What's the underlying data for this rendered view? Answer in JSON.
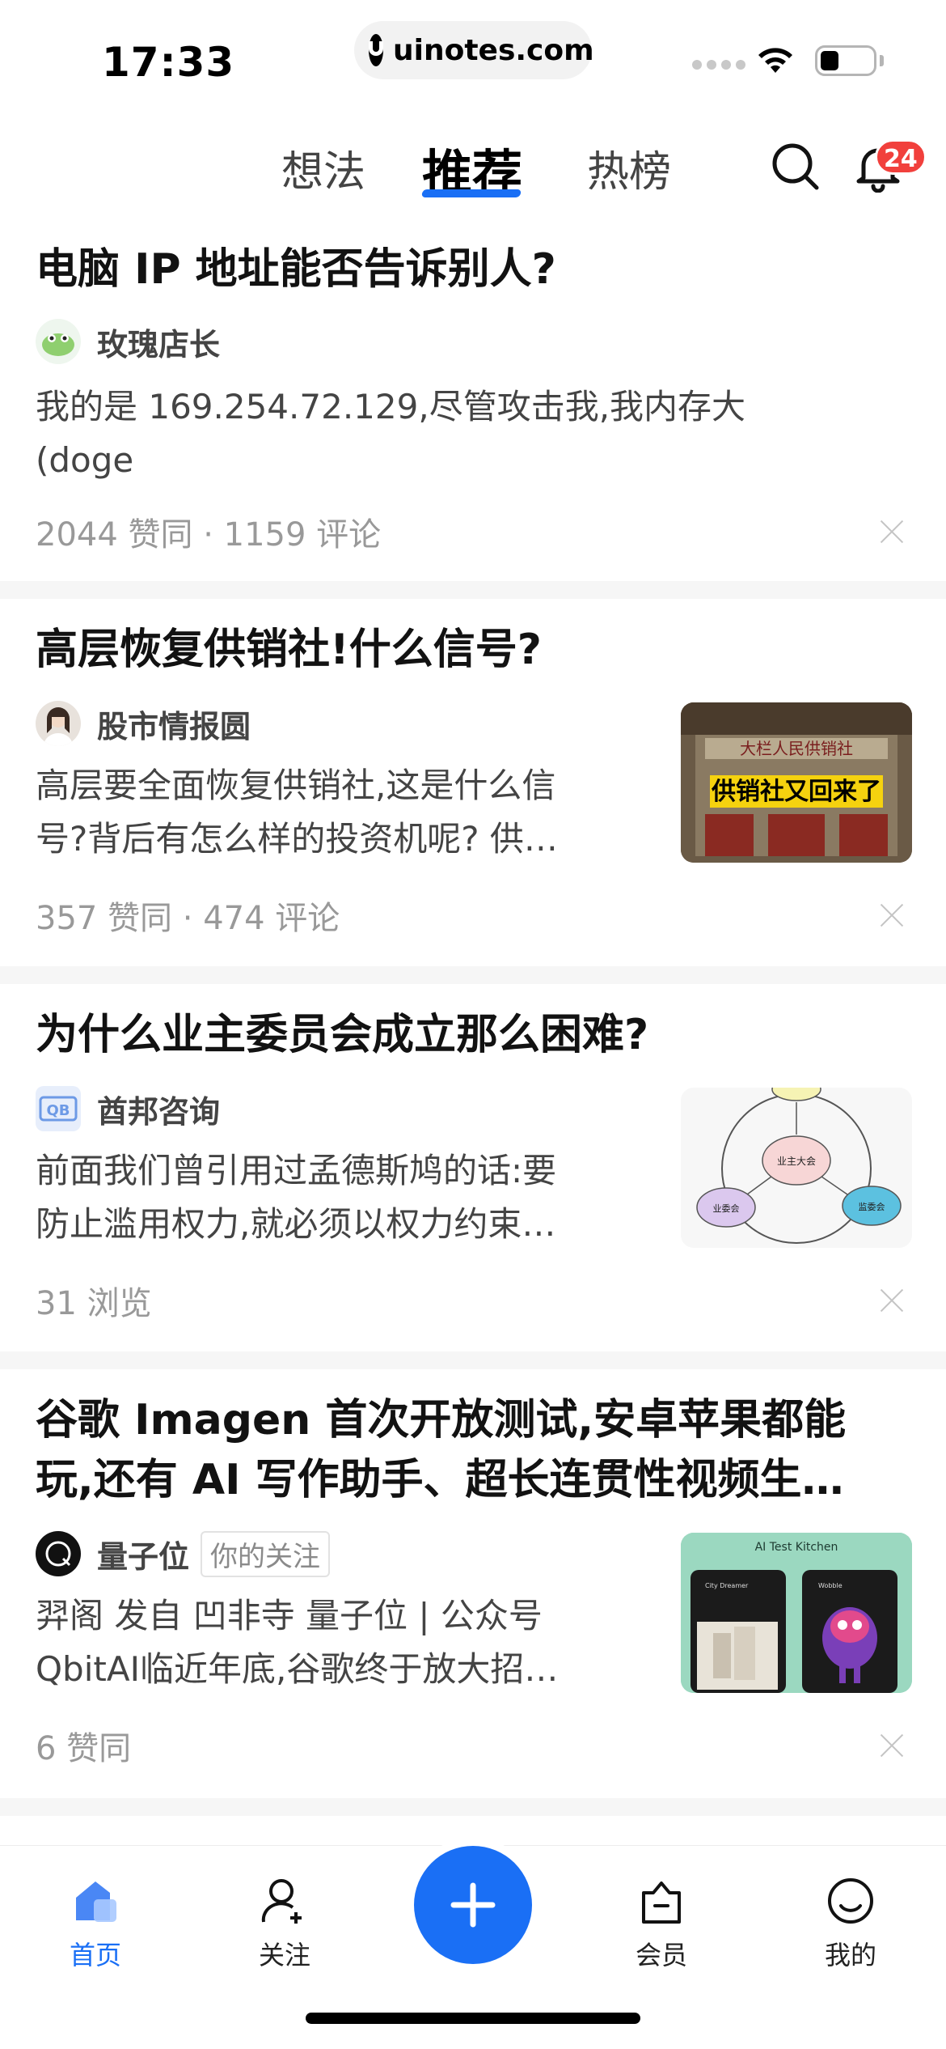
{
  "status_bar": {
    "time": "17:33",
    "url": "uinotes.com"
  },
  "top_nav": {
    "tabs": [
      {
        "label": "想法"
      },
      {
        "label": "推荐"
      },
      {
        "label": "热榜"
      }
    ],
    "active_tab": "推荐",
    "notification_count": "24"
  },
  "feed": [
    {
      "title": "电脑 IP 地址能否告诉别人?",
      "author": "玫瑰店长",
      "excerpt_line1": "我的是 169.254.72.129,尽管攻击我,我内存大",
      "excerpt_line2": "(doge",
      "meta": "2044 赞同 · 1159 评论"
    },
    {
      "title": "高层恢复供销社!什么信号?",
      "author": "股市情报圆",
      "excerpt_line1": "高层要全面恢复供销社,这是什么信",
      "excerpt_line2": "号?背后有怎么样的投资机呢? 供…",
      "meta": "357 赞同 · 474 评论",
      "thumb_sign": "大栏人民供销社",
      "thumb_banner": "供销社又回来了"
    },
    {
      "title": "为什么业主委员会成立那么困难?",
      "author": "酋邦咨询",
      "excerpt_line1": "前面我们曾引用过孟德斯鸠的话:要",
      "excerpt_line2": "防止滥用权力,就必须以权力约束…",
      "meta": "31 浏览",
      "thumb_nodes": [
        "业主大会",
        "业委会",
        "监委会"
      ]
    },
    {
      "title_line1": "谷歌 Imagen 首次开放测试,安卓苹果都能",
      "title_line2": "玩,还有 AI 写作助手、超长连贯性视频生…",
      "author": "量子位",
      "follow_tag": "你的关注",
      "excerpt_line1": "羿阁 发自 凹非寺 量子位 | 公众号",
      "excerpt_line2": "QbitAI临近年底,谷歌终于放大招…",
      "meta": "6 赞同",
      "thumb_caption": "AI Test Kitchen",
      "thumb_left_label": "City Dreamer",
      "thumb_right_label": "Wobble"
    }
  ],
  "bottom_nav": [
    {
      "label": "首页",
      "icon": "home-icon"
    },
    {
      "label": "关注",
      "icon": "add-person-icon"
    },
    {
      "label": "",
      "icon": "plus-icon"
    },
    {
      "label": "会员",
      "icon": "vip-bag-icon"
    },
    {
      "label": "我的",
      "icon": "profile-icon"
    }
  ],
  "colors": {
    "accent": "#1a6ff5",
    "badge": "#f1403c",
    "meta_text": "#999999",
    "separator": "#f6f6f6"
  }
}
